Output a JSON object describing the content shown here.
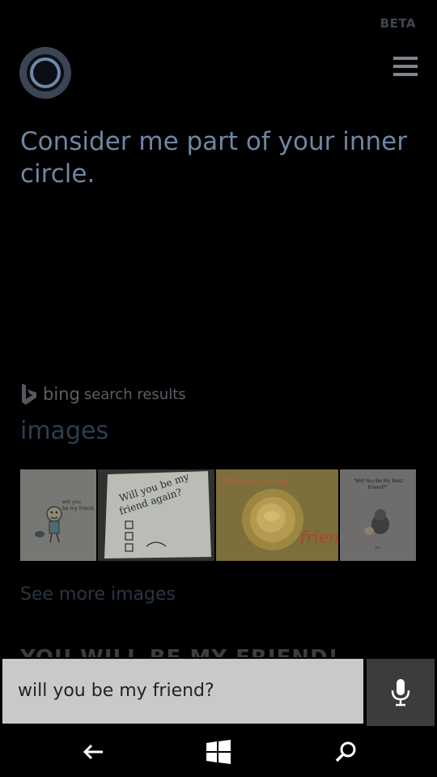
{
  "header": {
    "beta_label": "BETA"
  },
  "cortana": {
    "response_text": "Consider me part of your inner circle."
  },
  "results": {
    "bing_word": "bing",
    "bing_suffix": "search results",
    "images_heading": "images",
    "thumbnails": [
      {
        "icon": "cartoon-person-thumbnail",
        "caption": "will you be my friend"
      },
      {
        "icon": "handwritten-note-thumbnail",
        "caption": "Will you be my friend again?"
      },
      {
        "icon": "yellow-rose-thumbnail",
        "caption": "Will you be my friend"
      },
      {
        "icon": "kitten-card-thumbnail",
        "caption": "\"Will You Be My Best Friend?\""
      }
    ],
    "see_more_label": "See more images",
    "partial_heading": "YOU WILL BE MY FRIEND!"
  },
  "query": {
    "value": "will you be my friend?"
  },
  "icons": {
    "menu": "hamburger-menu-icon",
    "mic": "microphone-icon",
    "back": "back-arrow-icon",
    "start": "windows-logo-icon",
    "search": "search-icon"
  },
  "colors": {
    "background": "#000000",
    "accent": "#6f86a2",
    "query_box": "#c9c9c9",
    "mic_button": "#3c3c3c"
  }
}
